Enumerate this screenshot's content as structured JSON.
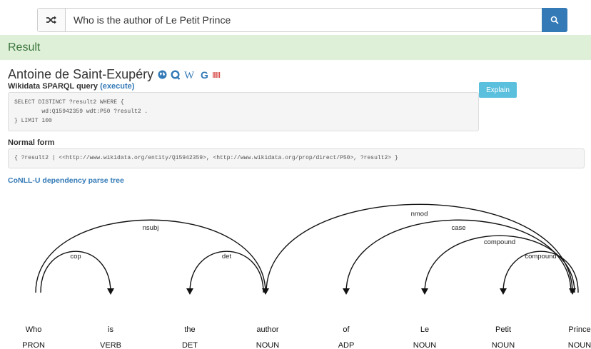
{
  "search": {
    "query": "Who is the author of Le Petit Prince"
  },
  "result": {
    "header": "Result",
    "answer": "Antoine de Saint-Exupéry",
    "icons": [
      "globe-icon",
      "q-icon",
      "wikipedia-icon",
      "google-icon",
      "barcode-icon"
    ]
  },
  "sparql": {
    "label": "Wikidata SPARQL query",
    "execute": "(execute)",
    "explain": "Explain",
    "code": "SELECT DISTINCT ?result2 WHERE {\n        wd:Q15942359 wdt:P50 ?result2 .\n} LIMIT 100"
  },
  "normal_form": {
    "label": "Normal form",
    "value": "{ ?result2 | <<http://www.wikidata.org/entity/Q15942359>, <http://www.wikidata.org/prop/direct/P50>, ?result2> }"
  },
  "parse": {
    "label": "CoNLL-U dependency parse tree",
    "tokens": [
      {
        "word": "Who",
        "pos": "PRON"
      },
      {
        "word": "is",
        "pos": "VERB"
      },
      {
        "word": "the",
        "pos": "DET"
      },
      {
        "word": "author",
        "pos": "NOUN"
      },
      {
        "word": "of",
        "pos": "ADP"
      },
      {
        "word": "Le",
        "pos": "NOUN"
      },
      {
        "word": "Petit",
        "pos": "NOUN"
      },
      {
        "word": "Prince",
        "pos": "NOUN"
      }
    ],
    "arcs": [
      {
        "from": 0,
        "to": 3,
        "label": "nsubj"
      },
      {
        "from": 0,
        "to": 1,
        "label": "cop"
      },
      {
        "from": 3,
        "to": 2,
        "label": "det"
      },
      {
        "from": 3,
        "to": 7,
        "label": "nmod"
      },
      {
        "from": 7,
        "to": 4,
        "label": "case"
      },
      {
        "from": 7,
        "to": 5,
        "label": "compound"
      },
      {
        "from": 7,
        "to": 6,
        "label": "compound"
      }
    ]
  }
}
